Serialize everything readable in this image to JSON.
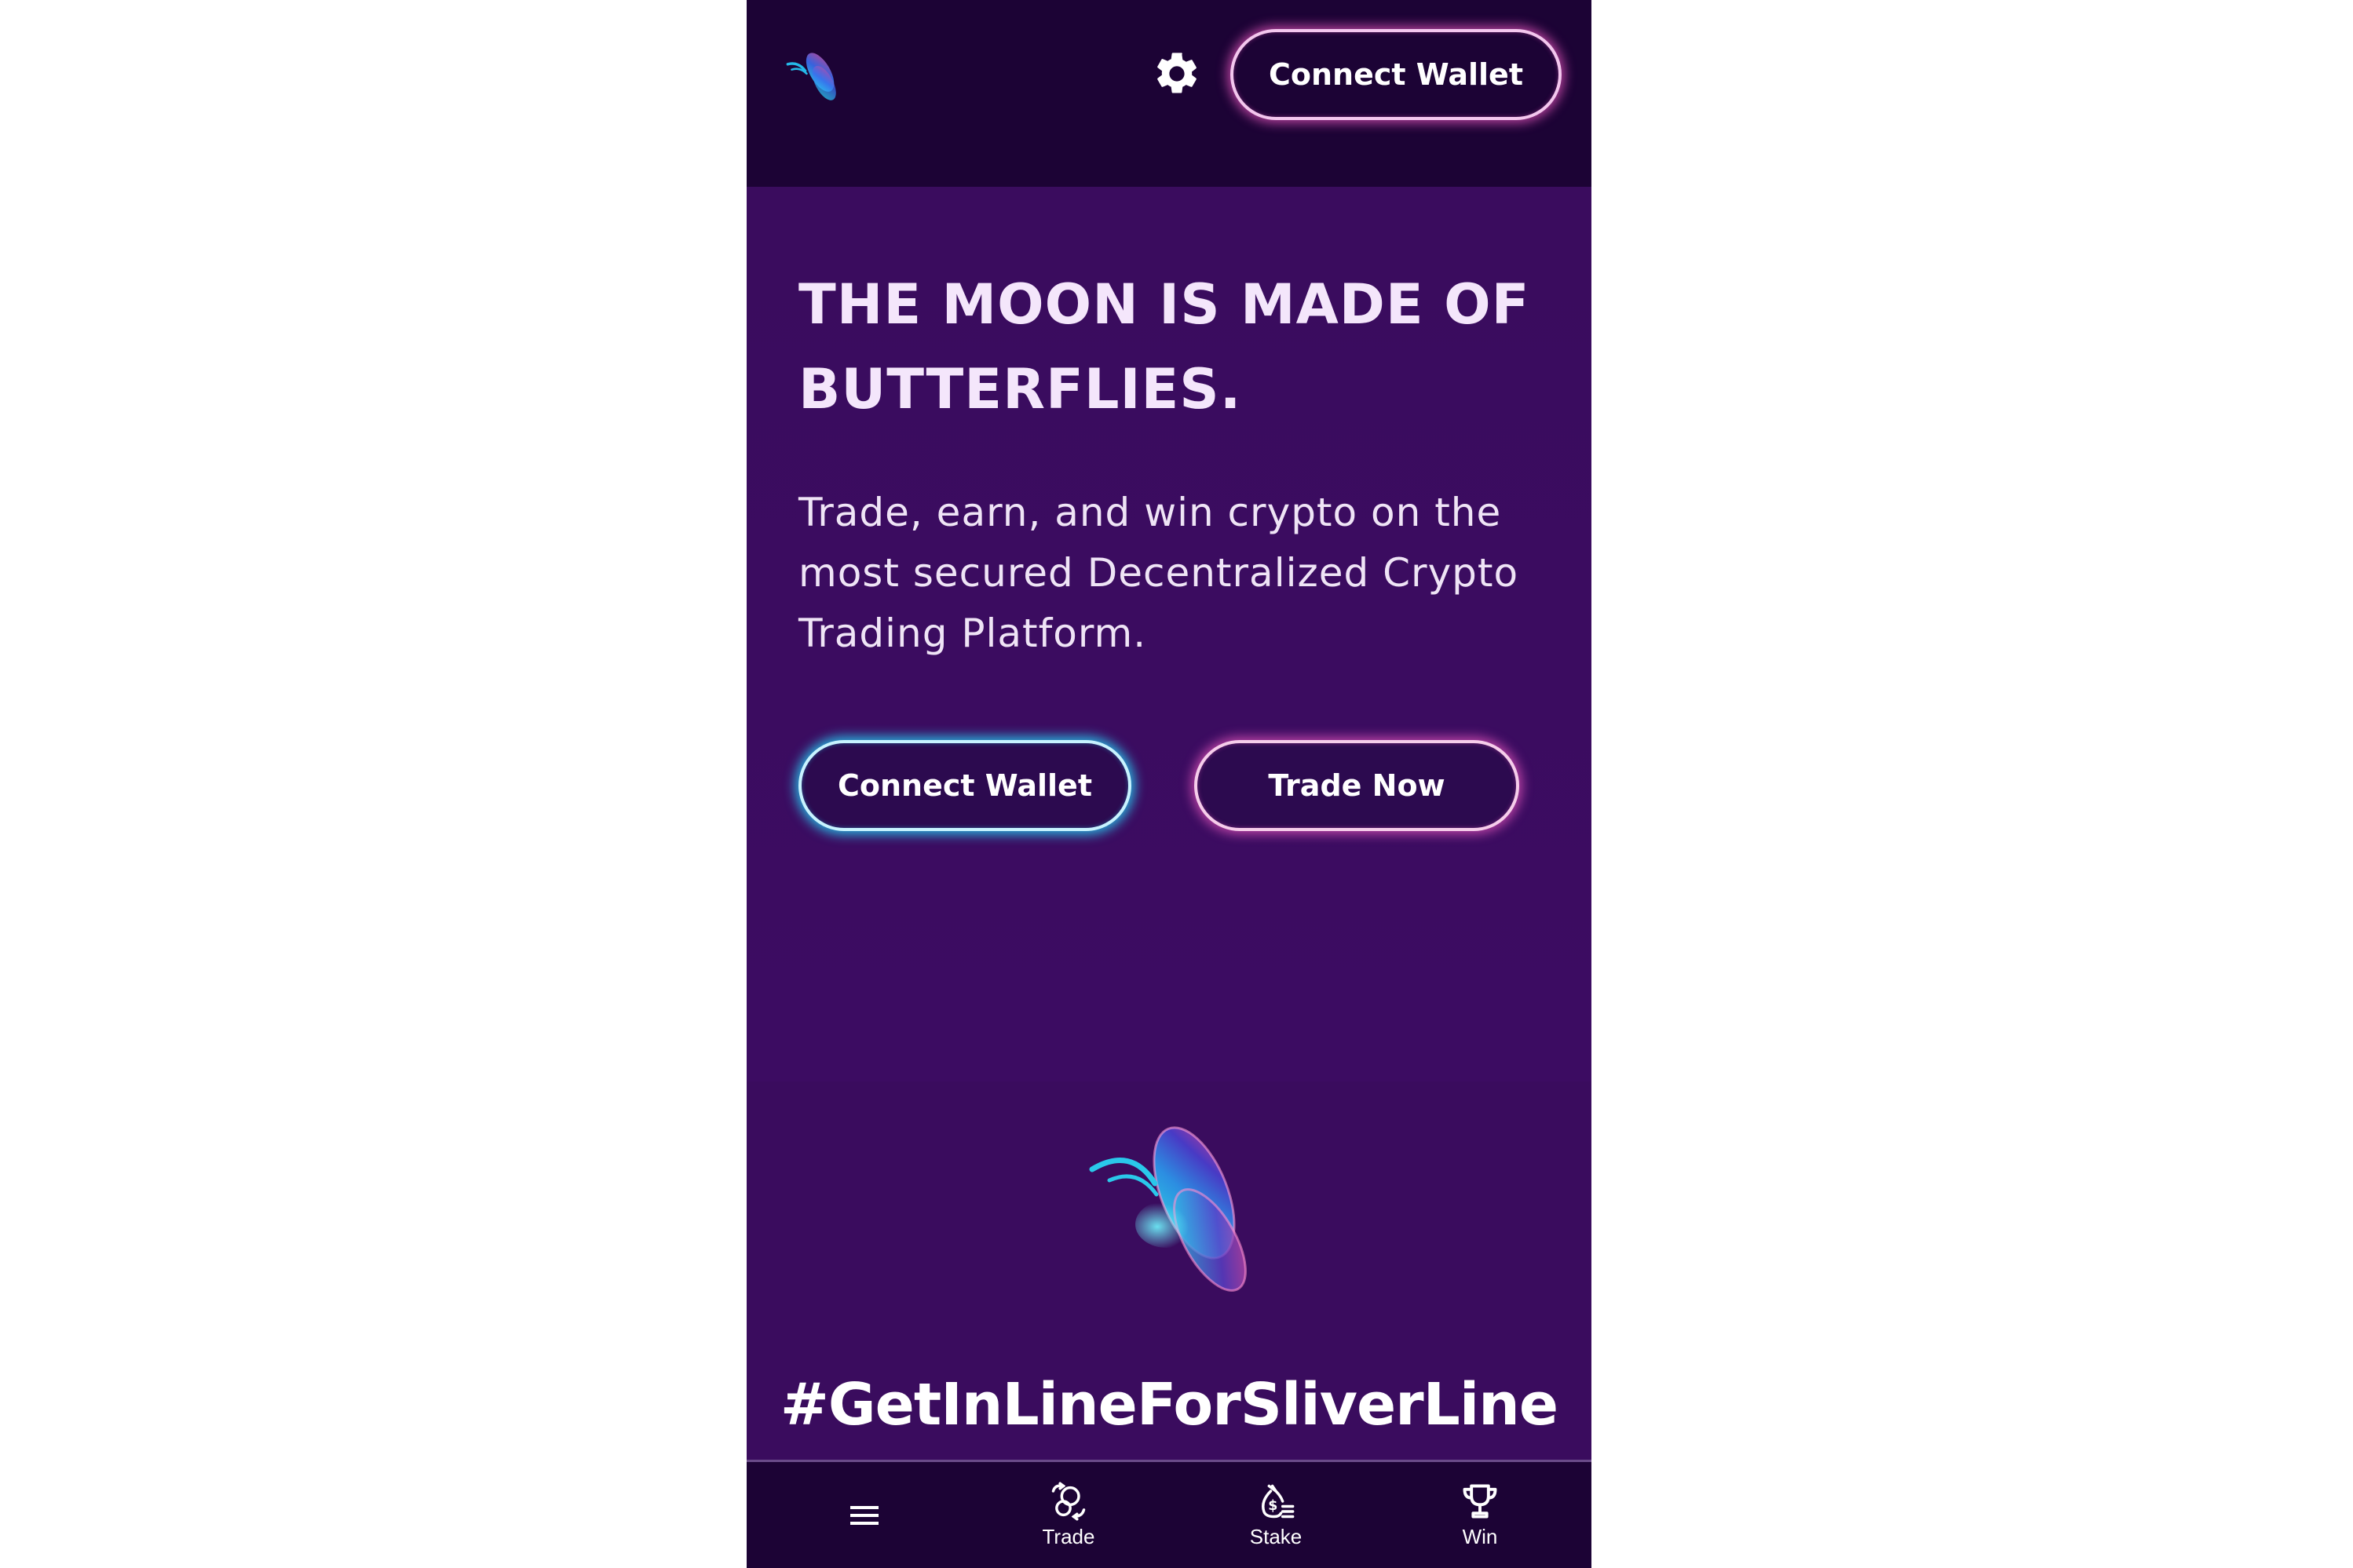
{
  "header": {
    "connect_wallet_label": "Connect Wallet"
  },
  "hero": {
    "headline": "THE MOON IS MADE OF BUTTERFLIES.",
    "subtitle": "Trade, earn, and win crypto on the most secured Decentralized Crypto Trading Platform.",
    "connect_wallet_label": "Connect Wallet",
    "trade_now_label": "Trade Now"
  },
  "hashtag": "#GetInLineForSliverLine",
  "bottom_nav": {
    "items": [
      {
        "icon": "hamburger-menu-icon",
        "label": ""
      },
      {
        "icon": "trade-icon",
        "label": "Trade"
      },
      {
        "icon": "money-bag-icon",
        "label": "Stake"
      },
      {
        "icon": "trophy-icon",
        "label": "Win"
      }
    ]
  },
  "colors": {
    "header_bg": "#1c0335",
    "page_bg": "#3a0c5e",
    "pink_glow": "#e254ba",
    "cyan_glow": "#27c4eb",
    "text": "#f4e6fb"
  }
}
